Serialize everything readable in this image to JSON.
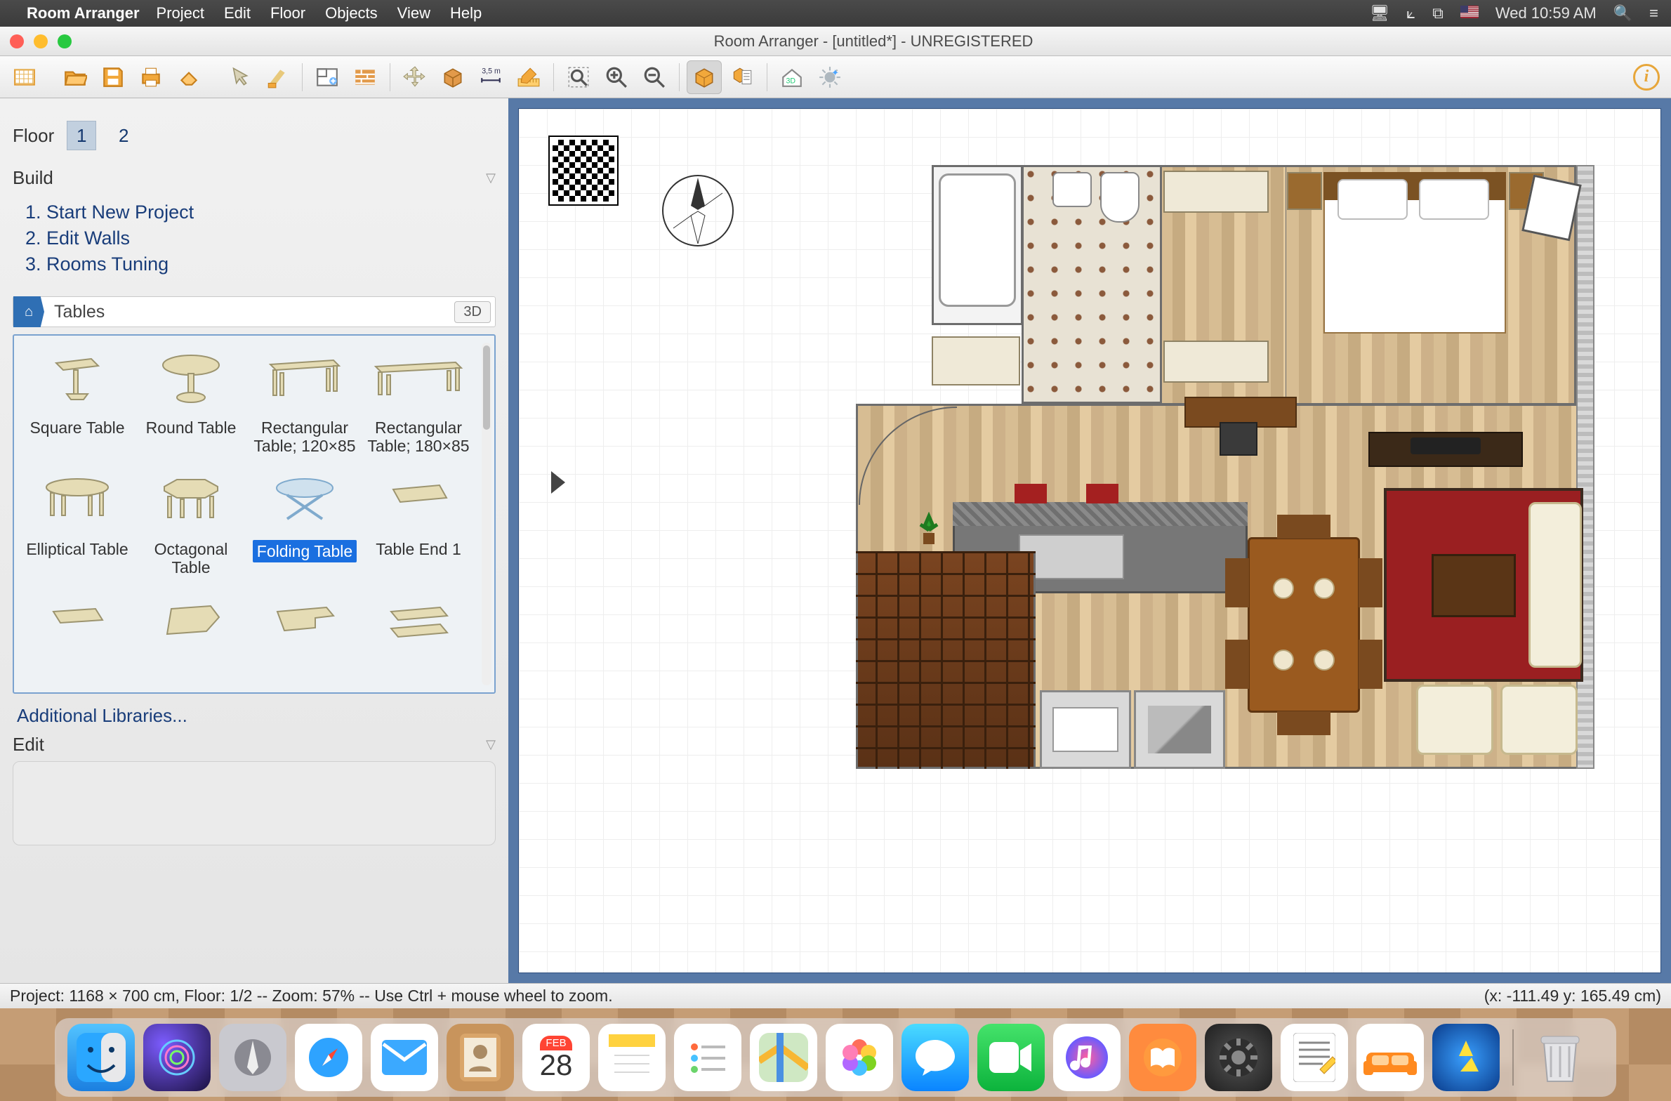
{
  "menubar": {
    "app_name": "Room Arranger",
    "items": [
      "Project",
      "Edit",
      "Floor",
      "Objects",
      "View",
      "Help"
    ],
    "clock": "Wed 10:59 AM"
  },
  "window": {
    "title": "Room Arranger - [untitled*] - UNREGISTERED"
  },
  "toolbar": {
    "buttons": [
      "new-project",
      "open",
      "save",
      "print",
      "undo",
      "redo",
      "paint",
      "room-setup",
      "wall",
      "measure",
      "insert-box",
      "ruler-3-5m",
      "ruler-edit",
      "zoom-fit",
      "zoom-in",
      "zoom-out",
      "view-3d",
      "view-list",
      "view-3d-house",
      "effects",
      "info"
    ],
    "active": "view-3d"
  },
  "sidepanel": {
    "floor_label": "Floor",
    "floors": [
      "1",
      "2"
    ],
    "floor_selected": "1",
    "build_label": "Build",
    "build_steps": [
      "1. Start New Project",
      "2. Edit Walls",
      "3. Rooms Tuning"
    ],
    "category_name": "Tables",
    "threeD_label": "3D",
    "tables": [
      {
        "name": "Square Table"
      },
      {
        "name": "Round Table"
      },
      {
        "name": "Rectangular Table; 120×85"
      },
      {
        "name": "Rectangular Table; 180×85"
      },
      {
        "name": "Elliptical Table"
      },
      {
        "name": "Octagonal Table"
      },
      {
        "name": "Folding Table",
        "selected": true
      },
      {
        "name": "Table End 1"
      },
      {
        "name": ""
      },
      {
        "name": ""
      },
      {
        "name": ""
      },
      {
        "name": ""
      }
    ],
    "additional_libraries": "Additional Libraries...",
    "edit_label": "Edit"
  },
  "statusbar": {
    "left": "Project: 1168 × 700 cm, Floor: 1/2 -- Zoom: 57% -- Use Ctrl + mouse wheel to zoom.",
    "right": "(x: -111.49 y: 165.49 cm)"
  },
  "dock": {
    "apps": [
      "finder",
      "siri",
      "launchpad",
      "safari",
      "mail",
      "contacts",
      "calendar",
      "notes",
      "reminders",
      "maps",
      "photos",
      "messages",
      "facetime",
      "itunes",
      "ibooks",
      "appstore",
      "preferences",
      "textedit",
      "room-arranger",
      "thunderbolt",
      "trash"
    ],
    "calendar_day": "28",
    "calendar_month": "FEB"
  }
}
